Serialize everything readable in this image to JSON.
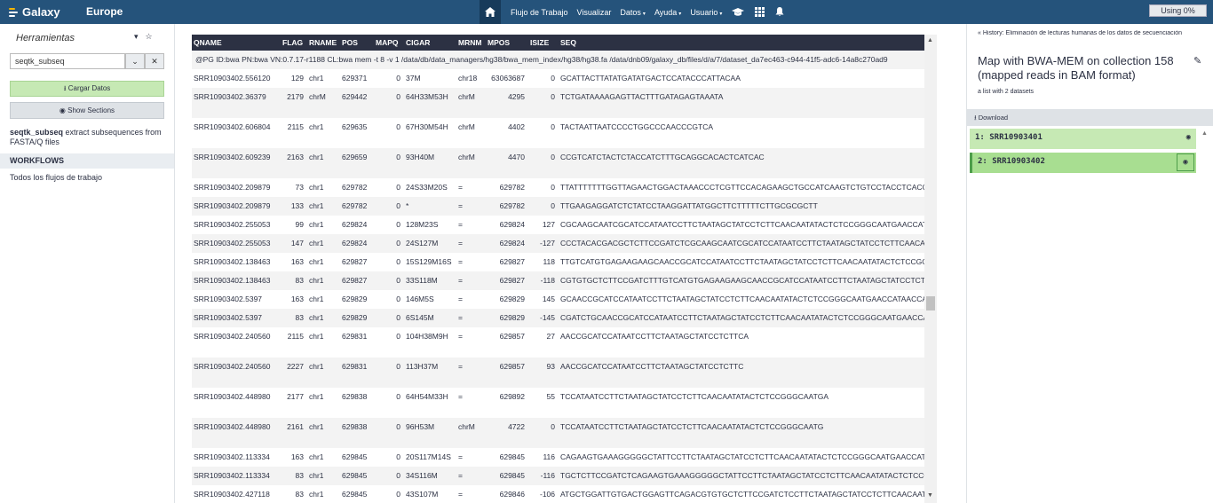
{
  "masthead": {
    "brand": "Galaxy",
    "subtitle": "Europe",
    "nav": [
      {
        "label": "Flujo de Trabajo",
        "caret": false
      },
      {
        "label": "Visualizar",
        "caret": false
      },
      {
        "label": "Datos",
        "caret": true
      },
      {
        "label": "Ayuda",
        "caret": true
      },
      {
        "label": "Usuario",
        "caret": true
      }
    ],
    "quota": "Using 0%"
  },
  "tools": {
    "heading": "Herramientas",
    "search_value": "seqtk_subseq",
    "upload_label": "Cargar Datos",
    "sections_label": "Show Sections",
    "result_name": "seqtk_subseq",
    "result_desc": " extract subsequences from FASTA/Q files",
    "workflows_heading": "WORKFLOWS",
    "workflows_link": "Todos los flujos de trabajo"
  },
  "dataset": {
    "columns": [
      "QNAME",
      "FLAG",
      "RNAME",
      "POS",
      "MAPQ",
      "CIGAR",
      "MRNM",
      "MPOS",
      "ISIZE",
      "SEQ"
    ],
    "header_line": "@PG ID:bwa PN:bwa VN:0.7.17-r1188 CL:bwa mem -t 8 -v 1 /data/db/data_managers/hg38/bwa_mem_index/hg38/hg38.fa /data/dnb09/galaxy_db/files/d/a/7/dataset_da7ec463-c944-41f5-adc6-14a8c270ad9",
    "rows": [
      {
        "qname": "SRR10903402.556120",
        "flag": "129",
        "rname": "chr1",
        "pos": "629371",
        "mapq": "0",
        "cigar": "37M",
        "mrnm": "chr18",
        "mpos": "63063687",
        "isize": "0",
        "seq": "GCATTACTTATATGATATGACTCCATACCCATTACAA",
        "tall": false
      },
      {
        "qname": "SRR10903402.36379",
        "flag": "2179",
        "rname": "chrM",
        "pos": "629442",
        "mapq": "0",
        "cigar": "64H33M53H",
        "mrnm": "chrM",
        "mpos": "4295",
        "isize": "0",
        "seq": "TCTGATAAAAGAGTTACTTTGATAGAGTAAATA",
        "tall": true
      },
      {
        "qname": "SRR10903402.606804",
        "flag": "2115",
        "rname": "chr1",
        "pos": "629635",
        "mapq": "0",
        "cigar": "67H30M54H",
        "mrnm": "chrM",
        "mpos": "4402",
        "isize": "0",
        "seq": "TACTAATTAATCCCCTGGCCCAACCCGTCA",
        "tall": true
      },
      {
        "qname": "SRR10903402.609239",
        "flag": "2163",
        "rname": "chr1",
        "pos": "629659",
        "mapq": "0",
        "cigar": "93H40M",
        "mrnm": "chrM",
        "mpos": "4470",
        "isize": "0",
        "seq": "CCGTCATCTACTCTACCATCTTTGCAGGCACACTCATCAC",
        "tall": true
      },
      {
        "qname": "SRR10903402.209879",
        "flag": "73",
        "rname": "chr1",
        "pos": "629782",
        "mapq": "0",
        "cigar": "24S33M20S",
        "mrnm": "=",
        "mpos": "629782",
        "isize": "0",
        "seq": "TTATTTTTTTGGTTAGAACTGGACTAAACCCTCGTTCCACAGAAGCTGCCATCAAGTCTGTCCTACCTCACGCC",
        "tall": false
      },
      {
        "qname": "SRR10903402.209879",
        "flag": "133",
        "rname": "chr1",
        "pos": "629782",
        "mapq": "0",
        "cigar": "*",
        "mrnm": "=",
        "mpos": "629782",
        "isize": "0",
        "seq": "TTGAAGAGGATCTCTATCCTAAGGATTATGGCTTCTTTTTCTTGCGCGCTT",
        "tall": false
      },
      {
        "qname": "SRR10903402.255053",
        "flag": "99",
        "rname": "chr1",
        "pos": "629824",
        "mapq": "0",
        "cigar": "128M23S",
        "mrnm": "=",
        "mpos": "629824",
        "isize": "127",
        "seq": "CGCAAGCAATCGCATCCATAATCCTTCTAATAGCTATCCTCTTCAACAATATACTCTCCGGGCAATGAACCATAA",
        "tall": false
      },
      {
        "qname": "SRR10903402.255053",
        "flag": "147",
        "rname": "chr1",
        "pos": "629824",
        "mapq": "0",
        "cigar": "24S127M",
        "mrnm": "=",
        "mpos": "629824",
        "isize": "-127",
        "seq": "CCCTACACGACGCTCTTCCGATCTCGCAAGCAATCGCATCCATAATCCTTCTAATAGCTATCCTCTTCAACAATA",
        "tall": false
      },
      {
        "qname": "SRR10903402.138463",
        "flag": "163",
        "rname": "chr1",
        "pos": "629827",
        "mapq": "0",
        "cigar": "15S129M16S",
        "mrnm": "=",
        "mpos": "629827",
        "isize": "118",
        "seq": "TTGTCATGTGAGAAGAAGCAACCGCATCCATAATCCTTCTAATAGCTATCCTCTTCAACAATATACTCTCCGGGC",
        "tall": false
      },
      {
        "qname": "SRR10903402.138463",
        "flag": "83",
        "rname": "chr1",
        "pos": "629827",
        "mapq": "0",
        "cigar": "33S118M",
        "mrnm": "=",
        "mpos": "629827",
        "isize": "-118",
        "seq": "CGTGTGCTCTTCCGATCTTTGTCATGTGAGAAGAAGCAACCGCATCCATAATCCTTCTAATAGCTATCCTCTTCA",
        "tall": false
      },
      {
        "qname": "SRR10903402.5397",
        "flag": "163",
        "rname": "chr1",
        "pos": "629829",
        "mapq": "0",
        "cigar": "146M5S",
        "mrnm": "=",
        "mpos": "629829",
        "isize": "145",
        "seq": "GCAACCGCATCCATAATCCTTCTAATAGCTATCCTCTTCAACAATATACTCTCCGGGCAATGAACCATAACCAAT",
        "tall": false
      },
      {
        "qname": "SRR10903402.5397",
        "flag": "83",
        "rname": "chr1",
        "pos": "629829",
        "mapq": "0",
        "cigar": "6S145M",
        "mrnm": "=",
        "mpos": "629829",
        "isize": "-145",
        "seq": "CGATCTGCAACCGCATCCATAATCCTTCTAATAGCTATCCTCTTCAACAATATACTCTCCGGGCAATGAACCATA",
        "tall": false
      },
      {
        "qname": "SRR10903402.240560",
        "flag": "2115",
        "rname": "chr1",
        "pos": "629831",
        "mapq": "0",
        "cigar": "104H38M9H",
        "mrnm": "=",
        "mpos": "629857",
        "isize": "27",
        "seq": "AACCGCATCCATAATCCTTCTAATAGCTATCCTCTTCA",
        "tall": true
      },
      {
        "qname": "SRR10903402.240560",
        "flag": "2227",
        "rname": "chr1",
        "pos": "629831",
        "mapq": "0",
        "cigar": "113H37M",
        "mrnm": "=",
        "mpos": "629857",
        "isize": "93",
        "seq": "AACCGCATCCATAATCCTTCTAATAGCTATCCTCTTC",
        "tall": true
      },
      {
        "qname": "SRR10903402.448980",
        "flag": "2177",
        "rname": "chr1",
        "pos": "629838",
        "mapq": "0",
        "cigar": "64H54M33H",
        "mrnm": "=",
        "mpos": "629892",
        "isize": "55",
        "seq": "TCCATAATCCTTCTAATAGCTATCCTCTTCAACAATATACTCTCCGGGCAATGA",
        "tall": true
      },
      {
        "qname": "SRR10903402.448980",
        "flag": "2161",
        "rname": "chr1",
        "pos": "629838",
        "mapq": "0",
        "cigar": "96H53M",
        "mrnm": "chrM",
        "mpos": "4722",
        "isize": "0",
        "seq": "TCCATAATCCTTCTAATAGCTATCCTCTTCAACAATATACTCTCCGGGCAATG",
        "tall": true
      },
      {
        "qname": "SRR10903402.113334",
        "flag": "163",
        "rname": "chr1",
        "pos": "629845",
        "mapq": "0",
        "cigar": "20S117M14S",
        "mrnm": "=",
        "mpos": "629845",
        "isize": "116",
        "seq": "CAGAAGTGAAAGGGGGCTATTCCTTCTAATAGCTATCCTCTTCAACAATATACTCTCCGGGCAATGAACCATAA",
        "tall": false
      },
      {
        "qname": "SRR10903402.113334",
        "flag": "83",
        "rname": "chr1",
        "pos": "629845",
        "mapq": "0",
        "cigar": "34S116M",
        "mrnm": "=",
        "mpos": "629845",
        "isize": "-116",
        "seq": "TGCTCTTCCGATCTCAGAAGTGAAAGGGGGCTATTCCTTCTAATAGCTATCCTCTTCAACAATATACTCTCCGGG",
        "tall": false
      },
      {
        "qname": "SRR10903402.427118",
        "flag": "83",
        "rname": "chr1",
        "pos": "629845",
        "mapq": "0",
        "cigar": "43S107M",
        "mrnm": "=",
        "mpos": "629846",
        "isize": "-106",
        "seq": "ATGCTGGATTGTGACTGGAGTTCAGACGTGTGCTCTTCCGATCTCCTTCTAATAGCTATCCTCTTCAACAATATA",
        "tall": false
      }
    ]
  },
  "history": {
    "link": "History: Eliminación de lecturas humanas de los datos de secuenciación",
    "title": "Map with BWA-MEM on collection 158 (mapped reads in BAM format)",
    "subtitle": "a list with 2 datasets",
    "download_label": "Download",
    "datasets": [
      {
        "label": "1: SRR10903401"
      },
      {
        "label": "2: SRR10903402"
      }
    ]
  },
  "colors": {
    "masthead": "#25537b",
    "table_header": "#2c3143",
    "dataset_ok": "#c6e9b4",
    "dataset_selected": "#a8de91"
  }
}
